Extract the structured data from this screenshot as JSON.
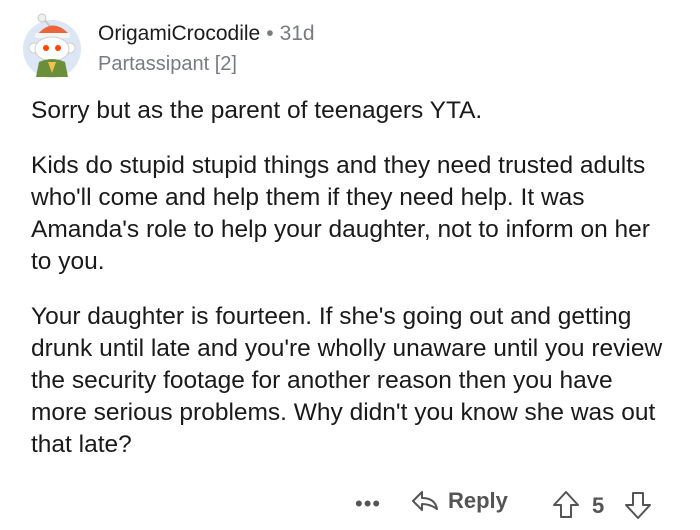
{
  "comment": {
    "author": "OrigamiCrocodile",
    "separator": "•",
    "age": "31d",
    "flair": "Partassipant [2]",
    "avatar_icon": "snoo-avatar-icon",
    "paragraphs": [
      "Sorry but as the parent of teenagers YTA.",
      "Kids do stupid stupid things and they need trusted adults who'll come and help them if they need help. It was Amanda's role to help your daughter, not to inform on her to you.",
      "Your daughter is fourteen. If she's going out and getting drunk until late and you're wholly unaware until you review the security footage for another reason then you have more serious problems. Why didn't you know she was out that late?"
    ]
  },
  "actions": {
    "more_label": "•••",
    "reply_label": "Reply",
    "score": "5",
    "icons": [
      "more-options-icon",
      "reply-arrow-icon",
      "upvote-icon",
      "downvote-icon"
    ]
  },
  "colors": {
    "text": "#1a1a1b",
    "meta": "#787c7e",
    "action": "#545454",
    "avatar_bg": "#dce6f5"
  }
}
